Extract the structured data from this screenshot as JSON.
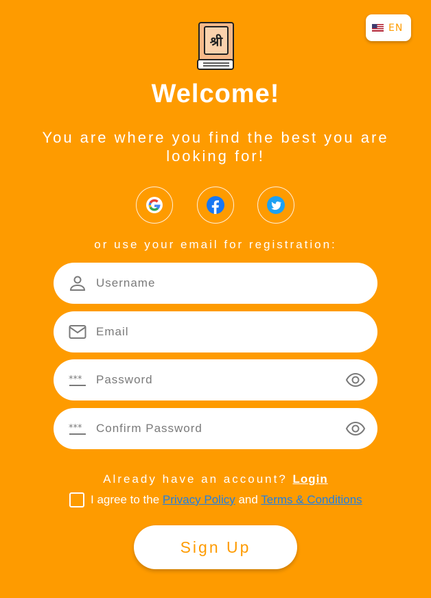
{
  "language": {
    "code": "EN",
    "flag_icon": "us-flag-icon"
  },
  "header": {
    "logo_icon": "book-logo-icon",
    "logo_text": "श्री",
    "title": "Welcome!",
    "subtitle": "You are where you find the best you are looking for!"
  },
  "social": {
    "buttons": [
      {
        "name": "google",
        "icon": "google-icon"
      },
      {
        "name": "facebook",
        "icon": "facebook-icon"
      },
      {
        "name": "twitter",
        "icon": "twitter-icon"
      }
    ],
    "or_text": "or use your email for registration:"
  },
  "form": {
    "username_placeholder": "Username",
    "email_placeholder": "Email",
    "password_placeholder": "Password",
    "confirm_password_placeholder": "Confirm Password",
    "icons": {
      "username": "user-icon",
      "email": "envelope-icon",
      "password": "password-dots-icon",
      "visibility": "eye-icon"
    }
  },
  "login_prompt": {
    "text": "Already have an account?",
    "link": "Login"
  },
  "agreement": {
    "prefix": "I agree to the",
    "privacy_link": "Privacy Policy",
    "and": "and",
    "terms_link": "Terms & Conditions",
    "checked": false
  },
  "submit": {
    "label": "Sign Up"
  },
  "colors": {
    "background": "#fe9b00",
    "accent": "#fe9b00",
    "link": "#1f7fe4",
    "logo_fill": "#f7b98a"
  }
}
